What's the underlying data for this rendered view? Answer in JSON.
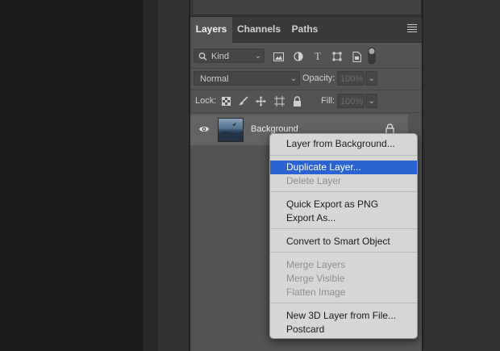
{
  "panel": {
    "tabs": [
      {
        "label": "Layers"
      },
      {
        "label": "Channels"
      },
      {
        "label": "Paths"
      }
    ],
    "menu_icon": "hamburger-icon"
  },
  "filter": {
    "kind_label": "Kind",
    "icons": [
      "image-filter-icon",
      "adjustment-filter-icon",
      "type-filter-icon",
      "shape-filter-icon",
      "smart-object-filter-icon",
      "filter-toggle-icon"
    ]
  },
  "blend": {
    "mode": "Normal",
    "opacity_label": "Opacity:",
    "opacity_value": "100%"
  },
  "lock": {
    "label": "Lock:",
    "icons": [
      "lock-transparent-icon",
      "lock-paint-icon",
      "lock-move-icon",
      "lock-artboard-icon",
      "lock-all-icon"
    ],
    "fill_label": "Fill:",
    "fill_value": "100%"
  },
  "layer": {
    "name": "Background",
    "visible": true
  },
  "context_menu": {
    "items": [
      {
        "label": "Layer from Background...",
        "enabled": true,
        "selected": false
      },
      {
        "label": "Duplicate Layer...",
        "enabled": true,
        "selected": true
      },
      {
        "label": "Delete Layer",
        "enabled": false,
        "selected": false
      },
      {
        "label": "Quick Export as PNG",
        "enabled": true,
        "selected": false
      },
      {
        "label": "Export As...",
        "enabled": true,
        "selected": false
      },
      {
        "label": "Convert to Smart Object",
        "enabled": true,
        "selected": false
      },
      {
        "label": "Merge Layers",
        "enabled": false,
        "selected": false
      },
      {
        "label": "Merge Visible",
        "enabled": false,
        "selected": false
      },
      {
        "label": "Flatten Image",
        "enabled": false,
        "selected": false
      },
      {
        "label": "New 3D Layer from File...",
        "enabled": true,
        "selected": false
      },
      {
        "label": "Postcard",
        "enabled": true,
        "selected": false
      }
    ]
  },
  "colors": {
    "selection": "#2c63d2",
    "panel_bg": "#535353",
    "menu_bg": "#d6d6d6"
  }
}
